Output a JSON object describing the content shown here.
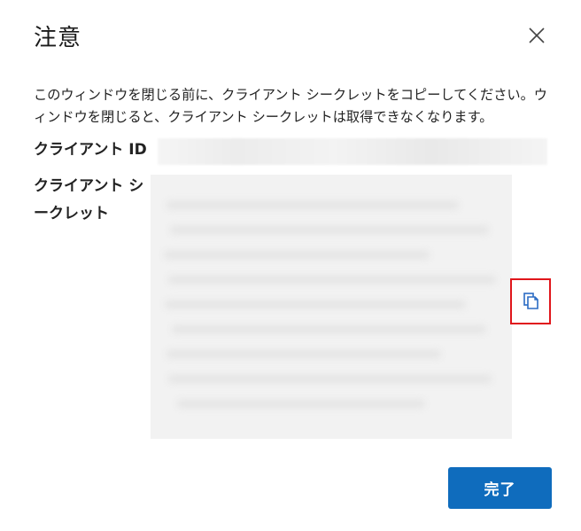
{
  "dialog": {
    "title": "注意",
    "close_icon": "close-icon",
    "message": "このウィンドウを閉じる前に、クライアント シークレットをコピーしてください。ウィンドウを閉じると、クライアント シークレットは取得できなくなります。",
    "client_id_label": "クライアント ID",
    "client_secret_label": "クライアント シークレット",
    "copy_icon": "copy-icon",
    "done_label": "完了",
    "colors": {
      "primary": "#0f6cbd",
      "highlight": "#e0161b"
    }
  }
}
